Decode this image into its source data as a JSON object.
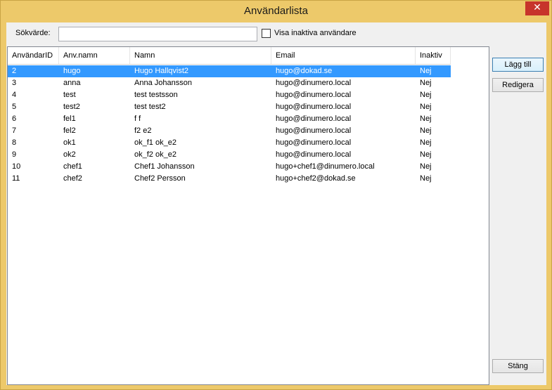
{
  "window": {
    "title": "Användarlista",
    "close_glyph": "✕"
  },
  "search": {
    "label": "Sökvärde:",
    "value": "",
    "placeholder": ""
  },
  "show_inactive": {
    "label": "Visa inaktiva användare",
    "checked": false
  },
  "table": {
    "columns": [
      "AnvändarID",
      "Anv.namn",
      "Namn",
      "Email",
      "Inaktiv"
    ],
    "selected_index": 0,
    "rows": [
      [
        "2",
        "hugo",
        "Hugo Hallqvist2",
        "hugo@dokad.se",
        "Nej"
      ],
      [
        "3",
        "anna",
        "Anna Johansson",
        "hugo@dinumero.local",
        "Nej"
      ],
      [
        "4",
        "test",
        "test testsson",
        "hugo@dinumero.local",
        "Nej"
      ],
      [
        "5",
        "test2",
        "test test2",
        "hugo@dinumero.local",
        "Nej"
      ],
      [
        "6",
        "fel1",
        "f f",
        "hugo@dinumero.local",
        "Nej"
      ],
      [
        "7",
        "fel2",
        "f2 e2",
        "hugo@dinumero.local",
        "Nej"
      ],
      [
        "8",
        "ok1",
        "ok_f1 ok_e2",
        "hugo@dinumero.local",
        "Nej"
      ],
      [
        "9",
        "ok2",
        "ok_f2 ok_e2",
        "hugo@dinumero.local",
        "Nej"
      ],
      [
        "10",
        "chef1",
        "Chef1 Johansson",
        "hugo+chef1@dinumero.local",
        "Nej"
      ],
      [
        "11",
        "chef2",
        "Chef2 Persson",
        "hugo+chef2@dokad.se",
        "Nej"
      ]
    ]
  },
  "buttons": {
    "add": "Lägg till",
    "edit": "Redigera",
    "close": "Stäng"
  }
}
